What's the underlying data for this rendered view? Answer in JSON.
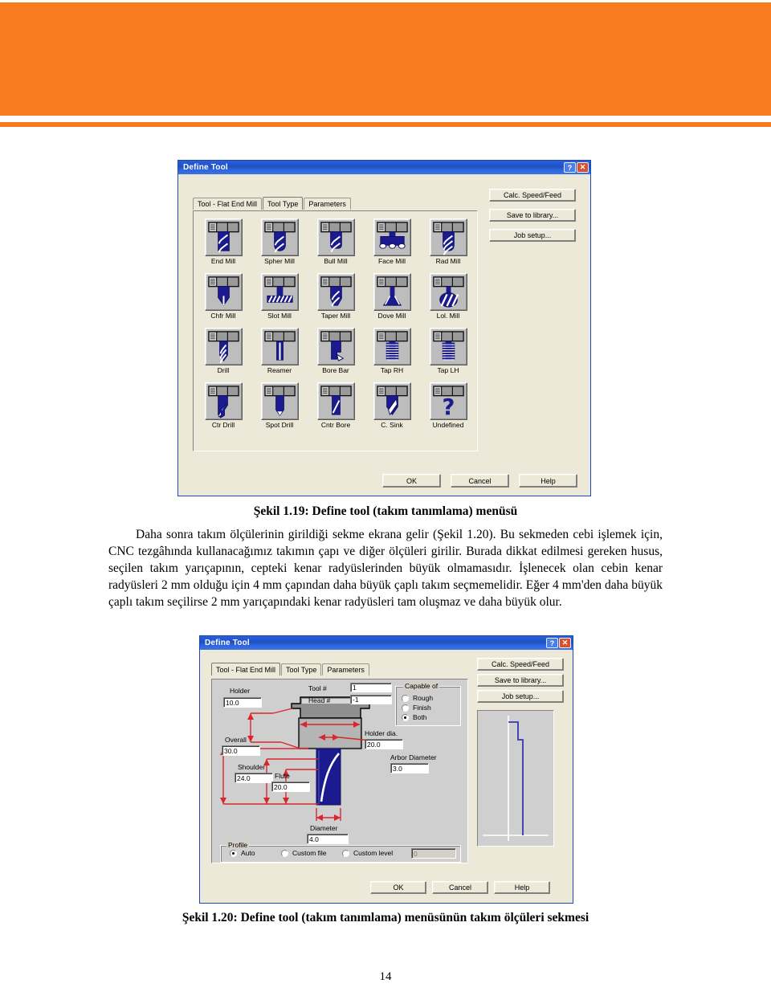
{
  "page": {
    "number": "14",
    "banner_color": "#F97B20"
  },
  "figure1": {
    "title": "Define Tool",
    "titlebar_buttons": {
      "help": "?",
      "close": "✕"
    },
    "tabs": [
      {
        "label": "Tool - Flat End Mill",
        "active": false
      },
      {
        "label": "Tool Type",
        "active": true
      },
      {
        "label": "Parameters",
        "active": false
      }
    ],
    "side_buttons": [
      "Calc. Speed/Feed",
      "Save to library...",
      "Job setup..."
    ],
    "tools": [
      {
        "label": "End Mill",
        "icon": "end-mill-icon"
      },
      {
        "label": "Spher Mill",
        "icon": "spherical-mill-icon"
      },
      {
        "label": "Bull Mill",
        "icon": "bull-mill-icon"
      },
      {
        "label": "Face Mill",
        "icon": "face-mill-icon"
      },
      {
        "label": "Rad Mill",
        "icon": "radius-mill-icon"
      },
      {
        "label": "Chfr Mill",
        "icon": "chamfer-mill-icon"
      },
      {
        "label": "Slot Mill",
        "icon": "slot-mill-icon"
      },
      {
        "label": "Taper Mill",
        "icon": "taper-mill-icon"
      },
      {
        "label": "Dove Mill",
        "icon": "dovetail-mill-icon"
      },
      {
        "label": "Lol. Mill",
        "icon": "lollipop-mill-icon"
      },
      {
        "label": "Drill",
        "icon": "drill-icon"
      },
      {
        "label": "Reamer",
        "icon": "reamer-icon"
      },
      {
        "label": "Bore Bar",
        "icon": "bore-bar-icon"
      },
      {
        "label": "Tap RH",
        "icon": "tap-rh-icon"
      },
      {
        "label": "Tap LH",
        "icon": "tap-lh-icon"
      },
      {
        "label": "Ctr Drill",
        "icon": "center-drill-icon"
      },
      {
        "label": "Spot Drill",
        "icon": "spot-drill-icon"
      },
      {
        "label": "Cntr Bore",
        "icon": "counter-bore-icon"
      },
      {
        "label": "C. Sink",
        "icon": "countersink-icon"
      },
      {
        "label": "Undefined",
        "icon": "undefined-tool-icon"
      }
    ],
    "footer_buttons": [
      "OK",
      "Cancel",
      "Help"
    ],
    "caption": "Şekil 1.19: Define tool (takım tanımlama) menüsü"
  },
  "body": {
    "paragraph": "Daha sonra takım ölçülerinin girildiği sekme ekrana gelir (Şekil 1.20). Bu sekmeden cebi işlemek için, CNC tezgâhında kullanacağımız takımın çapı ve diğer ölçüleri girilir. Burada dikkat edilmesi gereken husus, seçilen takım yarıçapının, cepteki kenar radyüslerinden büyük olmamasıdır. İşlenecek olan cebin kenar radyüsleri 2 mm olduğu için 4 mm çapından daha büyük çaplı takım seçmemelidir. Eğer 4 mm'den daha büyük çaplı takım seçilirse 2 mm yarıçapındaki kenar radyüsleri tam oluşmaz ve daha büyük olur."
  },
  "figure2": {
    "title": "Define Tool",
    "titlebar_buttons": {
      "help": "?",
      "close": "✕"
    },
    "tabs": [
      {
        "label": "Tool - Flat End Mill",
        "active": true
      },
      {
        "label": "Tool Type",
        "active": false
      },
      {
        "label": "Parameters",
        "active": false
      }
    ],
    "side_buttons": [
      "Calc. Speed/Feed",
      "Save to library...",
      "Job setup..."
    ],
    "fields": [
      {
        "name": "tool-number",
        "label": "Tool #",
        "value": "1"
      },
      {
        "name": "head-number",
        "label": "Head #",
        "value": "-1"
      },
      {
        "name": "holder-length",
        "label": "Holder",
        "value": "10.0"
      },
      {
        "name": "holder-dia",
        "label": "Holder dia.",
        "value": "20.0"
      },
      {
        "name": "arbor-diameter",
        "label": "Arbor Diameter",
        "value": "3.0"
      },
      {
        "name": "overall-length",
        "label": "Overall",
        "value": "30.0"
      },
      {
        "name": "shoulder-length",
        "label": "Shoulder",
        "value": "24.0"
      },
      {
        "name": "flute-length",
        "label": "Flute",
        "value": "20.0"
      },
      {
        "name": "diameter",
        "label": "Diameter",
        "value": "4.0"
      }
    ],
    "capable_of": {
      "caption": "Capable of",
      "options": [
        {
          "label": "Rough",
          "selected": false
        },
        {
          "label": "Finish",
          "selected": false
        },
        {
          "label": "Both",
          "selected": true
        }
      ]
    },
    "profile": {
      "caption": "Profile",
      "options": [
        {
          "label": "Auto",
          "selected": true
        },
        {
          "label": "Custom file",
          "selected": false
        },
        {
          "label": "Custom level",
          "selected": false
        }
      ],
      "custom_level_value": "0"
    },
    "footer_buttons": [
      "OK",
      "Cancel",
      "Help"
    ],
    "caption": "Şekil 1.20: Define tool (takım tanımlama) menüsünün takım ölçüleri sekmesi"
  }
}
